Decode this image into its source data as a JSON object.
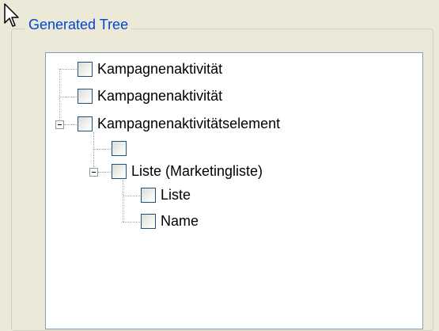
{
  "group": {
    "title": "Generated Tree"
  },
  "tree": {
    "nodes": [
      {
        "label": "Kampagnenaktivität",
        "level": 0,
        "expanded": null,
        "checked": false
      },
      {
        "label": "Kampagnenaktivität",
        "level": 0,
        "expanded": null,
        "checked": false
      },
      {
        "label": "Kampagnenaktivitätselement",
        "level": 0,
        "expanded": true,
        "checked": false
      },
      {
        "label": "",
        "level": 1,
        "expanded": null,
        "checked": false
      },
      {
        "label": "Liste (Marketingliste)",
        "level": 1,
        "expanded": true,
        "checked": false
      },
      {
        "label": "Liste",
        "level": 2,
        "expanded": null,
        "checked": false
      },
      {
        "label": "Name",
        "level": 2,
        "expanded": null,
        "checked": false
      }
    ]
  },
  "icons": {
    "cursor": "arrow-cursor-icon",
    "expander": "minus-icon",
    "checkbox": "checkbox-icon"
  },
  "colors": {
    "title": "#0046d5",
    "panel_border": "#7f9db9",
    "background": "#ece9d8"
  }
}
